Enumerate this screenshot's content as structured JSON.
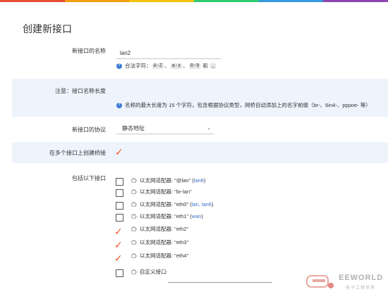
{
  "topbar_colors": [
    "#e94f37",
    "#f39c12",
    "#f1c40f",
    "#2ecc71",
    "#3498db",
    "#8e44ad"
  ],
  "title": "创建新接口",
  "name_field": {
    "label": "新接口的名称",
    "value": "lan2",
    "hint_prefix": "合法字符：",
    "hint_codes": [
      "A-Z",
      "a-z",
      "0-9"
    ],
    "hint_and": "和",
    "hint_last": "_",
    "hint_sep": "、"
  },
  "note": {
    "label": "注意：接口名称长度",
    "text": "名称的最大长度为 15 个字符，包含根据协议类型，网桥自动添加上的名字前缀（br-、6in4-、pppoe- 等）"
  },
  "protocol": {
    "label": "新接口的协议",
    "value": "静态地址",
    "icon": "chevron-down-icon"
  },
  "bridge": {
    "label": "在多个接口上创建桥接",
    "checked": true
  },
  "include": {
    "label": "包括以下接口",
    "items": [
      {
        "prefix": "以太网适配器: \"@lan\" (",
        "link": "lan6",
        "suffix": ")",
        "checked": false
      },
      {
        "prefix": "以太网适配器: \"br-lan\"",
        "link": "",
        "suffix": "",
        "checked": false
      },
      {
        "prefix": "以太网适配器: \"eth0\" (",
        "link": "lan, lan6",
        "suffix": ")",
        "checked": false
      },
      {
        "prefix": "以太网适配器: \"eth1\" (",
        "link": "wan",
        "suffix": ")",
        "checked": false
      },
      {
        "prefix": "以太网适配器: \"eth2\"",
        "link": "",
        "suffix": "",
        "checked": true
      },
      {
        "prefix": "以太网适配器: \"eth3\"",
        "link": "",
        "suffix": "",
        "checked": true
      },
      {
        "prefix": "以太网适配器: \"eth4\"",
        "link": "",
        "suffix": "",
        "checked": true
      },
      {
        "prefix": "自定义接口:",
        "link": "",
        "suffix": "",
        "checked": false
      }
    ]
  },
  "watermark": {
    "brand": "EEWORLD",
    "sub": "电子工程世界"
  }
}
